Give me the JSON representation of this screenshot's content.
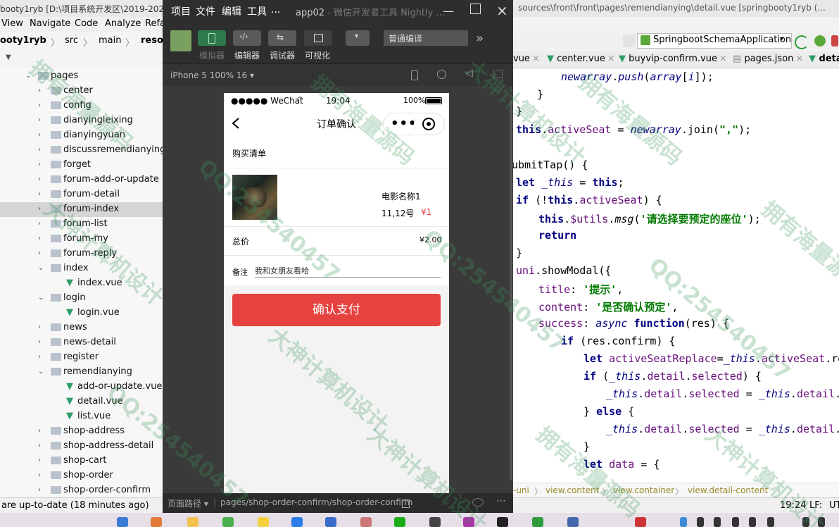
{
  "ide": {
    "title_left": "booty1ryb [D:\\项目系统开发区\\2019-2023",
    "title_right": "sources\\front\\front\\pages\\remendianying\\detail.vue [springbooty1ryb (...",
    "menu": [
      "View",
      "Navigate",
      "Code",
      "Analyze",
      "Refa"
    ],
    "breadcrumbs": [
      "ooty1ryb",
      "src",
      "main",
      "resou"
    ],
    "run_config": "SpringbootSchemaApplication",
    "tabs": [
      "vue",
      "center.vue",
      "buyvip-confirm.vue",
      "pages.json",
      "deta"
    ],
    "tree": [
      {
        "label": "pages",
        "level": 1,
        "type": "folder",
        "open": true
      },
      {
        "label": "center",
        "level": 2,
        "type": "folder"
      },
      {
        "label": "config",
        "level": 2,
        "type": "folder"
      },
      {
        "label": "dianyingleixing",
        "level": 2,
        "type": "folder"
      },
      {
        "label": "dianyingyuan",
        "level": 2,
        "type": "folder"
      },
      {
        "label": "discussremendianying",
        "level": 2,
        "type": "folder"
      },
      {
        "label": "forget",
        "level": 2,
        "type": "folder"
      },
      {
        "label": "forum-add-or-update",
        "level": 2,
        "type": "folder"
      },
      {
        "label": "forum-detail",
        "level": 2,
        "type": "folder"
      },
      {
        "label": "forum-index",
        "level": 2,
        "type": "folder",
        "selected": true
      },
      {
        "label": "forum-list",
        "level": 2,
        "type": "folder"
      },
      {
        "label": "forum-my",
        "level": 2,
        "type": "folder"
      },
      {
        "label": "forum-reply",
        "level": 2,
        "type": "folder"
      },
      {
        "label": "index",
        "level": 2,
        "type": "folder",
        "open": true
      },
      {
        "label": "index.vue",
        "level": 3,
        "type": "vue"
      },
      {
        "label": "login",
        "level": 2,
        "type": "folder",
        "open": true
      },
      {
        "label": "login.vue",
        "level": 3,
        "type": "vue"
      },
      {
        "label": "news",
        "level": 2,
        "type": "folder"
      },
      {
        "label": "news-detail",
        "level": 2,
        "type": "folder"
      },
      {
        "label": "register",
        "level": 2,
        "type": "folder"
      },
      {
        "label": "remendianying",
        "level": 2,
        "type": "folder",
        "open": true
      },
      {
        "label": "add-or-update.vue",
        "level": 3,
        "type": "vue"
      },
      {
        "label": "detail.vue",
        "level": 3,
        "type": "vue"
      },
      {
        "label": "list.vue",
        "level": 3,
        "type": "vue"
      },
      {
        "label": "shop-address",
        "level": 2,
        "type": "folder"
      },
      {
        "label": "shop-address-detail",
        "level": 2,
        "type": "folder"
      },
      {
        "label": "shop-cart",
        "level": 2,
        "type": "folder"
      },
      {
        "label": "shop-order",
        "level": 2,
        "type": "folder"
      },
      {
        "label": "shop-order-confirm",
        "level": 2,
        "type": "folder"
      }
    ],
    "code_crumbs": [
      "-uni",
      "view.content",
      "view.container",
      "view.detail-content"
    ],
    "status_left": "are up-to-date (18 minutes ago)",
    "status_time": "19:24",
    "status_lf": "LF:",
    "status_enc": "UT"
  },
  "devtools": {
    "menu": [
      "项目",
      "文件",
      "编辑",
      "工具",
      "..."
    ],
    "app_name": "app02",
    "app_suffix": " - 微信开发者工具 Nightly ...",
    "toolbar": [
      "模拟器",
      "编辑器",
      "调试器",
      "可视化"
    ],
    "compile_mode": "普通编译",
    "device": "iPhone 5 100% 16 ▾",
    "page_path_label": "页面路径 ▾",
    "page_path": "pages/shop-order-confirm/shop-order-confirm"
  },
  "phone": {
    "carrier": "●●●●● WeChat",
    "time": "19:04",
    "battery": "100%",
    "page_title": "订单确认",
    "section_title": "购买清单",
    "item_name": "电影名称1",
    "item_seats": "11,12号",
    "item_price": "¥1",
    "total_label": "总价",
    "total_value": "¥2.00",
    "remark_label": "备注",
    "remark_value": "我和女朋友看哈",
    "pay_button": "确认支付"
  },
  "watermark": [
    "大神计算机设计",
    "QQ:254540457",
    "拥有海量源码"
  ]
}
